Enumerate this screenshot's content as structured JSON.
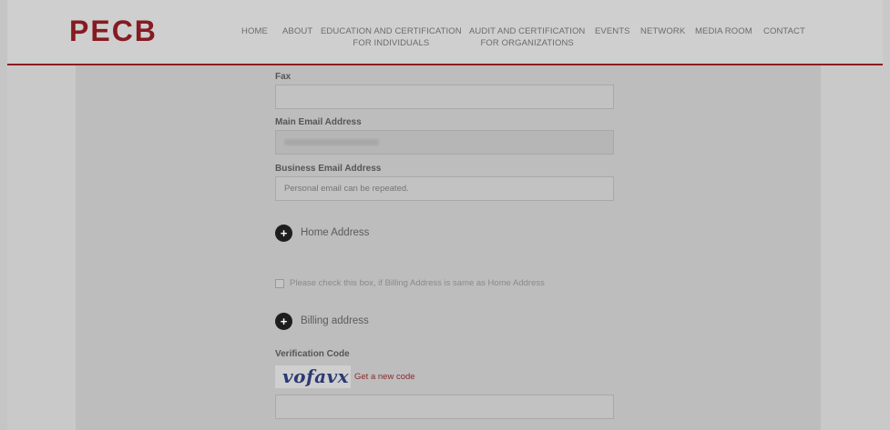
{
  "brand": {
    "logo_text": "PECB",
    "accent_color": "#861b22"
  },
  "nav": {
    "home": "HOME",
    "about": "ABOUT",
    "edu_line1": "EDUCATION AND CERTIFICATION",
    "edu_line2": "FOR INDIVIDUALS",
    "audit_line1": "AUDIT AND CERTIFICATION",
    "audit_line2": "FOR ORGANIZATIONS",
    "events": "EVENTS",
    "network": "NETWORK",
    "media": "MEDIA ROOM",
    "contact": "CONTACT"
  },
  "form": {
    "fax_label": "Fax",
    "fax_value": "",
    "main_email_label": "Main Email Address",
    "main_email_value": "[blurred]",
    "business_email_label": "Business Email Address",
    "business_email_placeholder": "Personal email can be repeated.",
    "home_address_label": "Home Address",
    "billing_same_label": "Please check this box, if Billing Address is same as Home Address",
    "billing_same_checked": false,
    "billing_address_label": "Billing address",
    "verification_label": "Verification Code",
    "captcha_text": "vofavx",
    "new_code_label": "Get a new code",
    "verification_value": ""
  }
}
